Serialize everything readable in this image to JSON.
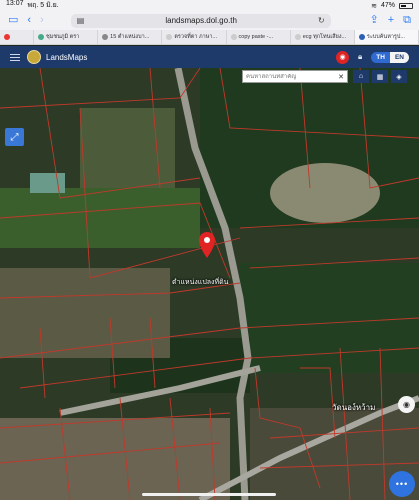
{
  "status_bar": {
    "time": "13:07",
    "date": "พฤ. 5 มิ.ย.",
    "battery": "47%"
  },
  "browser": {
    "url": "landsmaps.dol.go.th",
    "tabs": [
      {
        "label": ""
      },
      {
        "label": "ชุมชนภูมิ ตรา"
      },
      {
        "label": "15 ตำแหน่งบา..."
      },
      {
        "label": "ตรวจที่ตา ภาษา..."
      },
      {
        "label": "copy paste -..."
      },
      {
        "label": "ecg ทุกโทนเสียง..."
      },
      {
        "label": "ระบบค้นหารูป..."
      }
    ]
  },
  "app": {
    "name": "LandsMaps",
    "lang_th": "TH",
    "lang_en": "EN",
    "search_placeholder": "ค้นหาสถานที่สำคัญ"
  },
  "map": {
    "parcel_label": "ตำแหน่งแปลงที่ดิน",
    "place_label": "วัดนอง์หว้าม",
    "fab_label": "•••"
  },
  "icons": [
    "sidebar-icon",
    "back-icon",
    "forward-icon",
    "reader-icon",
    "reload-icon",
    "share-icon",
    "new-tab-icon",
    "tabs-icon",
    "menu-icon",
    "location-pin-icon",
    "lock-icon",
    "close-icon",
    "home-icon",
    "grid-icon",
    "layers-icon",
    "measure-icon",
    "compass-icon"
  ],
  "colors": {
    "header": "#1d3a6b",
    "accent": "#2f6ad0",
    "marker": "#e02424",
    "parcel_lines": "#c0392b"
  }
}
